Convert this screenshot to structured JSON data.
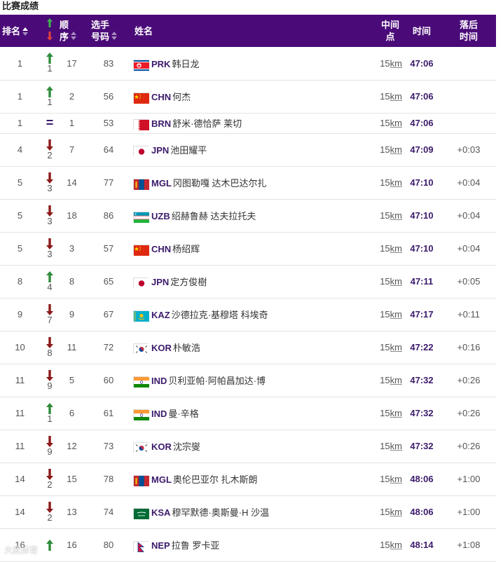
{
  "section_title": "比赛成绩",
  "headers": {
    "rank": "排名",
    "order_line1": "顺",
    "order_line2": "序",
    "bib_line1": "选手",
    "bib_line2": "号码",
    "name": "姓名",
    "split_line1": "中间",
    "split_line2": "点",
    "time": "时间",
    "behind_line1": "落后",
    "behind_line2": "时间"
  },
  "colors": {
    "header_bg": "#4a0a78",
    "up": "#2e8b3a",
    "down": "#8b1a1a",
    "accent": "#3b1a6b"
  },
  "rows": [
    {
      "rank": "1",
      "dir": "up",
      "change": "1",
      "order": "17",
      "bib": "83",
      "flag": "PRK",
      "noc": "PRK",
      "name": "韩日龙",
      "split": "15",
      "unit": "km",
      "time": "47:06",
      "behind": ""
    },
    {
      "rank": "1",
      "dir": "up",
      "change": "1",
      "order": "2",
      "bib": "56",
      "flag": "CHN",
      "noc": "CHN",
      "name": "何杰",
      "split": "15",
      "unit": "km",
      "time": "47:06",
      "behind": ""
    },
    {
      "rank": "1",
      "dir": "eq",
      "change": "=",
      "order": "1",
      "bib": "53",
      "flag": "BRN",
      "noc": "BRN",
      "name": "舒米·德恰萨 莱切",
      "split": "15",
      "unit": "km",
      "time": "47:06",
      "behind": ""
    },
    {
      "rank": "4",
      "dir": "down",
      "change": "2",
      "order": "7",
      "bib": "64",
      "flag": "JPN",
      "noc": "JPN",
      "name": "池田耀平",
      "split": "15",
      "unit": "km",
      "time": "47:09",
      "behind": "+0:03"
    },
    {
      "rank": "5",
      "dir": "down",
      "change": "3",
      "order": "14",
      "bib": "77",
      "flag": "MGL",
      "noc": "MGL",
      "name": "冈图勒嘎 达木巴达尔扎",
      "split": "15",
      "unit": "km",
      "time": "47:10",
      "behind": "+0:04"
    },
    {
      "rank": "5",
      "dir": "down",
      "change": "3",
      "order": "18",
      "bib": "86",
      "flag": "UZB",
      "noc": "UZB",
      "name": "绍赫鲁赫 达夫拉托夫",
      "split": "15",
      "unit": "km",
      "time": "47:10",
      "behind": "+0:04"
    },
    {
      "rank": "5",
      "dir": "down",
      "change": "3",
      "order": "3",
      "bib": "57",
      "flag": "CHN",
      "noc": "CHN",
      "name": "杨绍辉",
      "split": "15",
      "unit": "km",
      "time": "47:10",
      "behind": "+0:04"
    },
    {
      "rank": "8",
      "dir": "up",
      "change": "4",
      "order": "8",
      "bib": "65",
      "flag": "JPN",
      "noc": "JPN",
      "name": "定方俊樹",
      "split": "15",
      "unit": "km",
      "time": "47:11",
      "behind": "+0:05"
    },
    {
      "rank": "9",
      "dir": "down",
      "change": "7",
      "order": "9",
      "bib": "67",
      "flag": "KAZ",
      "noc": "KAZ",
      "name": "沙德拉克·基穆塔 科埃奇",
      "split": "15",
      "unit": "km",
      "time": "47:17",
      "behind": "+0:11"
    },
    {
      "rank": "10",
      "dir": "down",
      "change": "8",
      "order": "11",
      "bib": "72",
      "flag": "KOR",
      "noc": "KOR",
      "name": "朴敏浩",
      "split": "15",
      "unit": "km",
      "time": "47:22",
      "behind": "+0:16"
    },
    {
      "rank": "11",
      "dir": "down",
      "change": "9",
      "order": "5",
      "bib": "60",
      "flag": "IND",
      "noc": "IND",
      "name": "贝利亚帕·阿帕昌加达·博",
      "split": "15",
      "unit": "km",
      "time": "47:32",
      "behind": "+0:26"
    },
    {
      "rank": "11",
      "dir": "up",
      "change": "1",
      "order": "6",
      "bib": "61",
      "flag": "IND",
      "noc": "IND",
      "name": "曼·辛格",
      "split": "15",
      "unit": "km",
      "time": "47:32",
      "behind": "+0:26"
    },
    {
      "rank": "11",
      "dir": "down",
      "change": "9",
      "order": "12",
      "bib": "73",
      "flag": "KOR",
      "noc": "KOR",
      "name": "沈宗燮",
      "split": "15",
      "unit": "km",
      "time": "47:32",
      "behind": "+0:26"
    },
    {
      "rank": "14",
      "dir": "down",
      "change": "2",
      "order": "15",
      "bib": "78",
      "flag": "MGL",
      "noc": "MGL",
      "name": "奥伦巴亚尔 扎木斯朗",
      "split": "15",
      "unit": "km",
      "time": "48:06",
      "behind": "+1:00"
    },
    {
      "rank": "14",
      "dir": "down",
      "change": "2",
      "order": "13",
      "bib": "74",
      "flag": "KSA",
      "noc": "KSA",
      "name": "穆罕默德·奥斯曼·H 沙温",
      "split": "15",
      "unit": "km",
      "time": "48:06",
      "behind": "+1:00"
    },
    {
      "rank": "16",
      "dir": "up",
      "change": "",
      "order": "16",
      "bib": "80",
      "flag": "NEP",
      "noc": "NEP",
      "name": "拉鲁 罗卡亚",
      "split": "15",
      "unit": "km",
      "time": "48:14",
      "behind": "+1:08"
    }
  ],
  "watermark": "大武体育"
}
